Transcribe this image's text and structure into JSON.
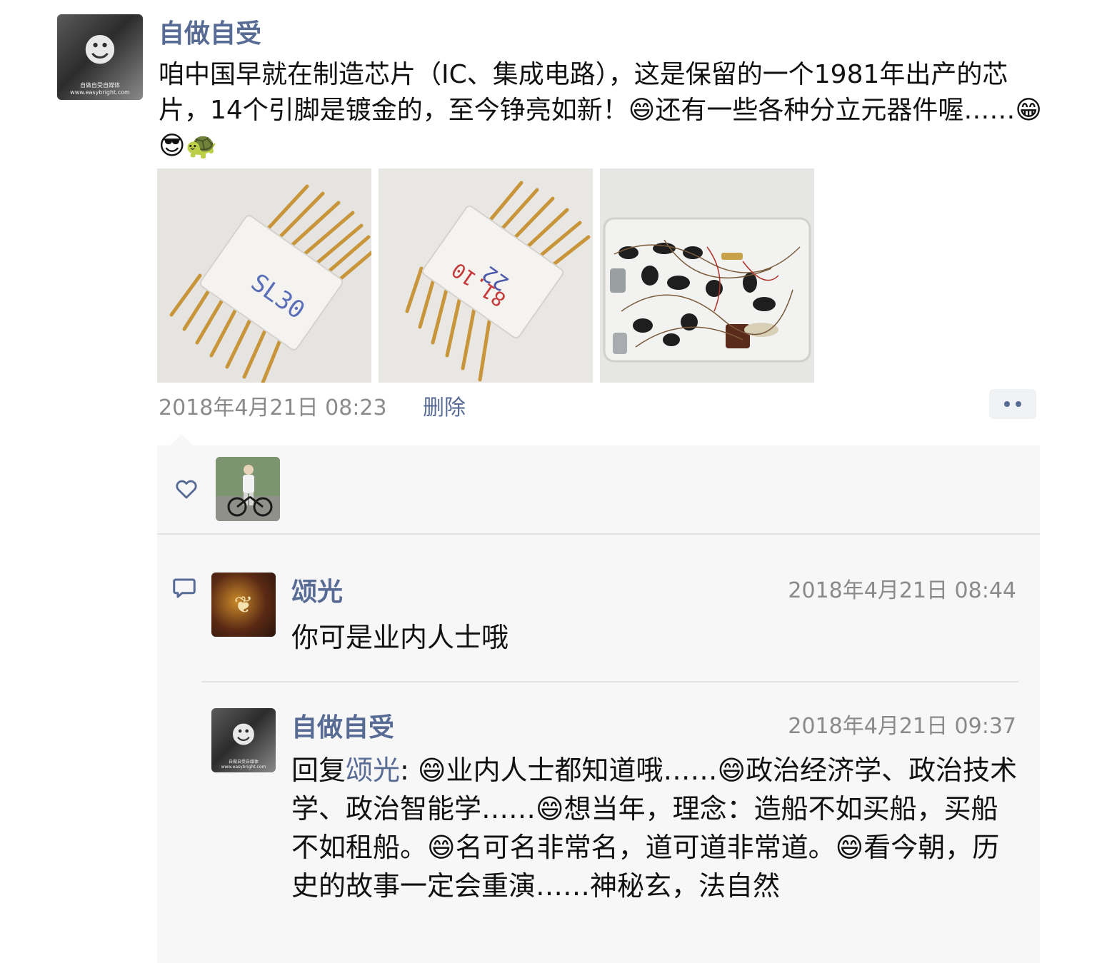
{
  "post": {
    "author": "自做自受",
    "avatar_watermark": "自做自受自媒体 www.easybright.com",
    "text": "咱中国早就在制造芯片（IC、集成电路），这是保留的一个1981年出产的芯片，14个引脚是镀金的，至今铮亮如新！😄还有一些各种分立元器件喔……😁😎🐢",
    "photos": [
      {
        "name": "chip-front-photo",
        "chip_label_1": "SL30"
      },
      {
        "name": "chip-back-photo",
        "chip_label_1": "22",
        "chip_label_2": "81.10"
      },
      {
        "name": "components-box-photo"
      }
    ],
    "timestamp": "2018年4月21日 08:23",
    "delete_label": "删除"
  },
  "likes": {
    "icon": "heart-icon"
  },
  "comments": [
    {
      "author": "颂光",
      "time": "2018年4月21日 08:44",
      "text": "你可是业内人士哦"
    },
    {
      "author": "自做自受",
      "time": "2018年4月21日 09:37",
      "reply_prefix": "回复",
      "reply_target": "颂光",
      "reply_colon": ": ",
      "text": "😄业内人士都知道哦……😄政治经济学、政治技术学、政治智能学……😄想当年，理念：造船不如买船，买船不如租船。😄名可名非常名，道可道非常道。😄看今朝，历史的故事一定会重演……神秘玄，法自然"
    }
  ],
  "colors": {
    "link_blue": "#576b95",
    "meta_gray": "#8a8a8a",
    "panel_bg": "#f7f7f7"
  }
}
